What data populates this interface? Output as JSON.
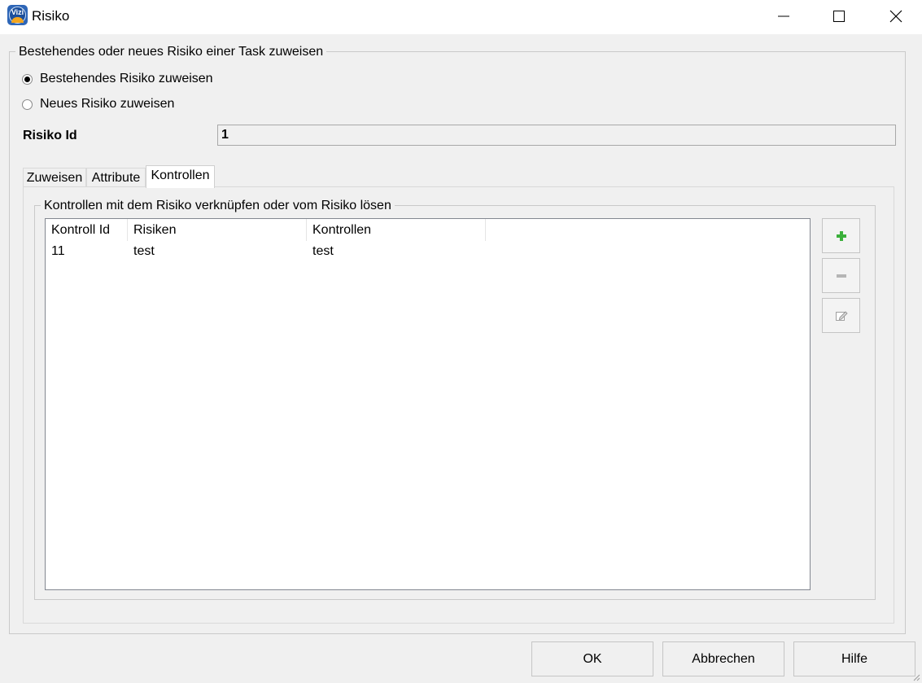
{
  "window": {
    "title": "Risiko",
    "app_icon": "vizi-logo-icon",
    "controls": [
      "minimize-icon",
      "maximize-icon",
      "close-icon"
    ]
  },
  "assign_group": {
    "legend": "Bestehendes oder neues Risiko einer Task zuweisen",
    "options": [
      {
        "label": "Bestehendes Risiko zuweisen",
        "checked": true
      },
      {
        "label": "Neues Risiko zuweisen",
        "checked": false
      }
    ]
  },
  "risiko_id": {
    "label": "Risiko Id",
    "value": "1"
  },
  "tabs": [
    {
      "label": "Zuweisen",
      "active": false
    },
    {
      "label": "Attribute",
      "active": false
    },
    {
      "label": "Kontrollen",
      "active": true
    }
  ],
  "controls_group": {
    "legend": "Kontrollen mit dem Risiko verknüpfen oder vom Risiko lösen",
    "columns": [
      "Kontroll Id",
      "Risiken",
      "Kontrollen"
    ],
    "rows": [
      [
        "11",
        "test",
        "test"
      ]
    ],
    "side_buttons": [
      {
        "icon": "plus-icon",
        "color": "#3bb03b",
        "enabled": true
      },
      {
        "icon": "minus-icon",
        "color": "#b5b5b5",
        "enabled": false
      },
      {
        "icon": "edit-icon",
        "color": "#a0a0a0",
        "enabled": false
      }
    ]
  },
  "footer": {
    "ok": "OK",
    "cancel": "Abbrechen",
    "help": "Hilfe"
  }
}
